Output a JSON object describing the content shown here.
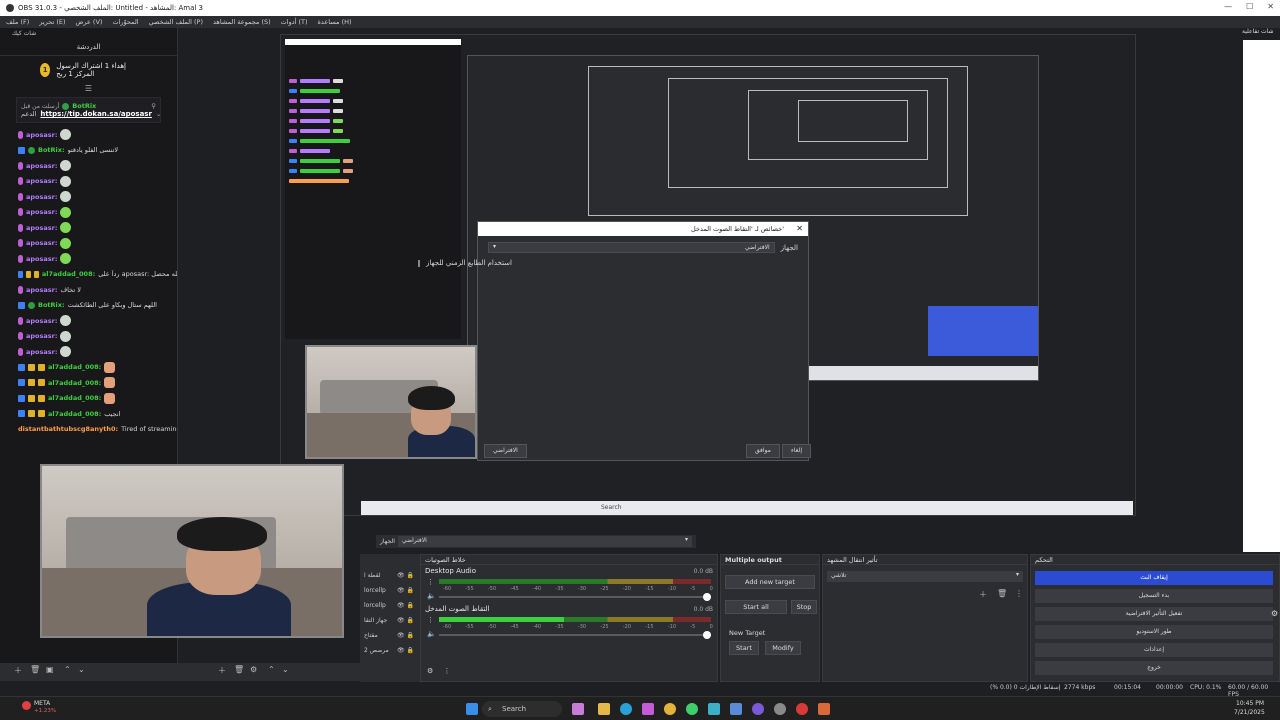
{
  "window": {
    "title": "OBS 31.0.3 - الملف الشخصي: Untitled - المشاهد: Amal 3",
    "controls": [
      "—",
      "☐",
      "✕"
    ]
  },
  "menu": [
    "ملف (F)",
    "تحرير (E)",
    "عرض (V)",
    "المحوّرات",
    "الملف الشخصي (P)",
    "مجموعة المشاهد (S)",
    "أدوات (T)",
    "مساعدة (H)"
  ],
  "chat": {
    "header": "شات كيك",
    "title": "الدردشة",
    "gift_count": "1",
    "gift_text": "إهداء 1 اشتراك الرسول المركز 1 ربح",
    "pinned_user": "BotRix",
    "pinned_prefix": "أرسلت من قبل",
    "pinned_link": "https://tip.dokan.sa/aposasr",
    "pinned_suffix": "الدعم",
    "messages": [
      {
        "user": "aposasr:",
        "color": "#b47cff",
        "text": "",
        "emote": "w",
        "badge": "mic"
      },
      {
        "user": "BotRix:",
        "color": "#3ecf3e",
        "text": "لاتنسى الفلو يادقتو",
        "emote": "",
        "badge": "bot"
      },
      {
        "user": "aposasr:",
        "color": "#b47cff",
        "text": "",
        "emote": "w",
        "badge": "mic"
      },
      {
        "user": "aposasr:",
        "color": "#b47cff",
        "text": "",
        "emote": "w",
        "badge": "mic"
      },
      {
        "user": "aposasr:",
        "color": "#b47cff",
        "text": "",
        "emote": "w",
        "badge": "mic"
      },
      {
        "user": "aposasr:",
        "color": "#b47cff",
        "text": "",
        "emote": "g",
        "badge": "mic"
      },
      {
        "user": "aposasr:",
        "color": "#b47cff",
        "text": "",
        "emote": "g",
        "badge": "mic"
      },
      {
        "user": "aposasr:",
        "color": "#b47cff",
        "text": "",
        "emote": "g",
        "badge": "mic"
      },
      {
        "user": "aposasr:",
        "color": "#b47cff",
        "text": "",
        "emote": "g",
        "badge": "mic"
      },
      {
        "user": "al7addad_008:",
        "color": "#3ecf3e",
        "text": "رداً على aposasr: والله محصل 😂😂😂",
        "emote": "",
        "badge": "sub"
      },
      {
        "user": "aposasr:",
        "color": "#b47cff",
        "text": "لا تخاف",
        "emote": "",
        "badge": "mic"
      },
      {
        "user": "BotRix:",
        "color": "#3ecf3e",
        "text": "اللهم ستال وبكاو على الطائكشت",
        "emote": "",
        "badge": "bot"
      },
      {
        "user": "aposasr:",
        "color": "#b47cff",
        "text": "",
        "emote": "w",
        "badge": "mic"
      },
      {
        "user": "aposasr:",
        "color": "#b47cff",
        "text": "",
        "emote": "w",
        "badge": "mic"
      },
      {
        "user": "aposasr:",
        "color": "#b47cff",
        "text": "",
        "emote": "w",
        "badge": "mic"
      },
      {
        "user": "al7addad_008:",
        "color": "#3ecf3e",
        "text": "",
        "emote": "h",
        "badge": "sub"
      },
      {
        "user": "al7addad_008:",
        "color": "#3ecf3e",
        "text": "",
        "emote": "h",
        "badge": "sub"
      },
      {
        "user": "al7addad_008:",
        "color": "#3ecf3e",
        "text": "",
        "emote": "h",
        "badge": "sub"
      },
      {
        "user": "al7addad_008:",
        "color": "#3ecf3e",
        "text": "انجيب",
        "emote": "",
        "badge": "sub"
      },
      {
        "user": "distantbathtubscg8anyth0:",
        "color": "#ff9e4a",
        "text": "Tired of streaming",
        "emote": "",
        "badge": ""
      }
    ]
  },
  "right_dock": {
    "title": "شات تفاعلية"
  },
  "preview": {
    "dialog": {
      "title": "خصائص لـ 'التقاط الصوت المدخل'",
      "close": "✕",
      "device_label": "الجهاز",
      "device_value": "الافتراضي",
      "checkbox_label": "استخدام الطابع الزمني للجهاز",
      "defaults_button": "الافتراضي",
      "ok_button": "موافق",
      "cancel_button": "إلغاء"
    },
    "inner_search": "Search"
  },
  "sources": {
    "items": [
      "لقطة ا",
      "lorcellp",
      "lorcellp",
      "جهاز التقا",
      "مقتاح",
      "مرصص 2"
    ]
  },
  "device_bar": {
    "label": "الجهاز",
    "value": "الافتراضي"
  },
  "audio": {
    "title": "خلاط الصوتيات",
    "channels": [
      {
        "name": "Desktop Audio",
        "db": "0.0 dB",
        "level": 0.0
      },
      {
        "name": "التقاط الصوت المدخل",
        "db": "0.0 dB",
        "level": 0.46
      }
    ],
    "scale": [
      "-60",
      "-55",
      "-50",
      "-45",
      "-40",
      "-35",
      "-30",
      "-25",
      "-20",
      "-15",
      "-10",
      "-5",
      "0"
    ]
  },
  "multi_output": {
    "title": "Multiple output",
    "add_target": "Add new target",
    "start_all": "Start all",
    "stop_all": "Stop",
    "new_target": "New Target",
    "start": "Start",
    "modify": "Modify"
  },
  "transitions": {
    "title": "تأثير انتقال المشهد",
    "value": "تلاشي"
  },
  "controls": {
    "title": "التحكم",
    "buttons": [
      "إيقاف البث",
      "بدء التسجيل",
      "تفعيل التأثير الافتراضية",
      "طور الاستوديو",
      "إعدادات",
      "خروج"
    ]
  },
  "status": {
    "frames": "إسقاط الإطارات 0 (0.0 %)",
    "bitrate": "2774 kbps",
    "stream_time": "00:15:04",
    "rec_time": "00:00:00",
    "cpu": "CPU: 0.1%",
    "fps": "60.00 / 60.00 FPS"
  },
  "taskbar": {
    "weather_label": "META",
    "weather_value": "+1.23%",
    "search": "Search",
    "time": "10:45 PM",
    "date": "7/21/2025"
  }
}
